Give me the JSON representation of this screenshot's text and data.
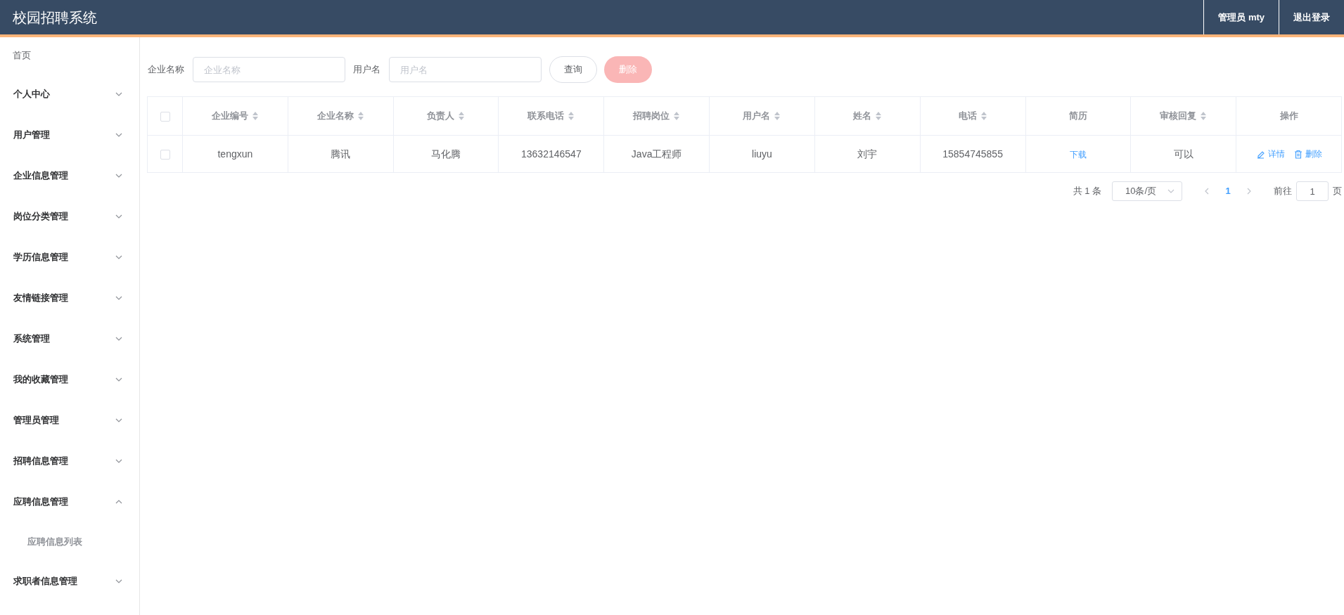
{
  "header": {
    "title": "校园招聘系统",
    "user": "管理员 mty",
    "logout": "退出登录"
  },
  "sidebar": {
    "home": "首页",
    "items": [
      {
        "label": "个人中心",
        "expanded": false
      },
      {
        "label": "用户管理",
        "expanded": false
      },
      {
        "label": "企业信息管理",
        "expanded": false
      },
      {
        "label": "岗位分类管理",
        "expanded": false
      },
      {
        "label": "学历信息管理",
        "expanded": false
      },
      {
        "label": "友情链接管理",
        "expanded": false
      },
      {
        "label": "系统管理",
        "expanded": false
      },
      {
        "label": "我的收藏管理",
        "expanded": false
      },
      {
        "label": "管理员管理",
        "expanded": false
      },
      {
        "label": "招聘信息管理",
        "expanded": false
      },
      {
        "label": "应聘信息管理",
        "expanded": true,
        "children": [
          {
            "label": "应聘信息列表"
          }
        ]
      },
      {
        "label": "求职者信息管理",
        "expanded": false
      }
    ]
  },
  "search": {
    "fields": [
      {
        "label": "企业名称",
        "placeholder": "企业名称"
      },
      {
        "label": "用户名",
        "placeholder": "用户名"
      }
    ],
    "query_button": "查询",
    "delete_button": "删除"
  },
  "table": {
    "select_all_checked": false,
    "columns": [
      {
        "label": "企业编号",
        "sortable": true
      },
      {
        "label": "企业名称",
        "sortable": true
      },
      {
        "label": "负责人",
        "sortable": true
      },
      {
        "label": "联系电话",
        "sortable": true
      },
      {
        "label": "招聘岗位",
        "sortable": true
      },
      {
        "label": "用户名",
        "sortable": true
      },
      {
        "label": "姓名",
        "sortable": true
      },
      {
        "label": "电话",
        "sortable": true
      },
      {
        "label": "简历",
        "sortable": false
      },
      {
        "label": "审核回复",
        "sortable": true
      },
      {
        "label": "操作",
        "sortable": false
      }
    ],
    "rows": [
      {
        "checked": false,
        "cells": [
          "tengxun",
          "腾讯",
          "马化腾",
          "13632146547",
          "Java工程师",
          "liuyu",
          "刘宇",
          "15854745855"
        ],
        "resume_link": "下载",
        "reply": "可以",
        "actions": [
          "详情",
          "删除"
        ]
      }
    ]
  },
  "pagination": {
    "total": "共 1 条",
    "page_size": "10条/页",
    "pages": [
      {
        "label": "1",
        "selected": true
      }
    ],
    "goto_label": "前往",
    "goto_value": "1",
    "goto_suffix": "页"
  }
}
